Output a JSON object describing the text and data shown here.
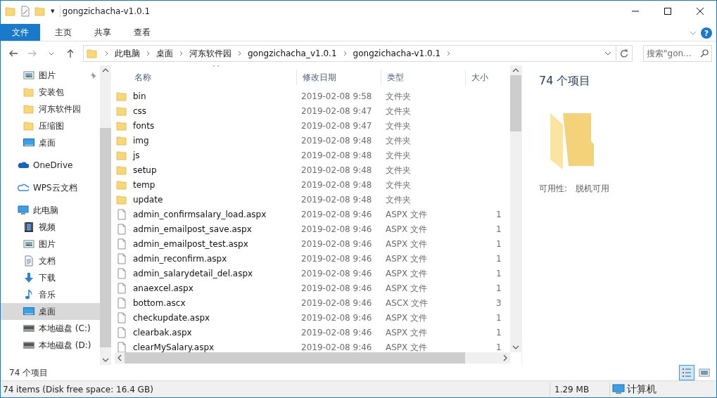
{
  "window": {
    "title": "gongzichacha-v1.0.1",
    "qat_dropdown": "▾"
  },
  "ribbon": {
    "tabs": [
      {
        "label": "文件",
        "selected": false,
        "kind": "file"
      },
      {
        "label": "主页",
        "selected": false,
        "kind": "tab"
      },
      {
        "label": "共享",
        "selected": false,
        "kind": "tab"
      },
      {
        "label": "查看",
        "selected": false,
        "kind": "tab"
      }
    ],
    "help_glyph": "?"
  },
  "address_bar": {
    "segments": [
      "此电脑",
      "桌面",
      "河东软件园",
      "gongzichacha_v1.0.1",
      "gongzichacha-v1.0.1"
    ],
    "search_placeholder": "搜索\"gon..."
  },
  "sidebar": {
    "quick_access": [
      {
        "label": "图片",
        "kind": "pictures",
        "pinned": true,
        "selected": false
      },
      {
        "label": "安装包",
        "kind": "folder",
        "pinned": false,
        "selected": false
      },
      {
        "label": "河东软件园",
        "kind": "folder",
        "pinned": false,
        "selected": false
      },
      {
        "label": "压缩图",
        "kind": "folder",
        "pinned": false,
        "selected": false
      },
      {
        "label": "桌面",
        "kind": "desktop",
        "pinned": false,
        "selected": false
      }
    ],
    "tree": [
      {
        "label": "OneDrive",
        "kind": "onedrive",
        "selected": false
      },
      {
        "label": "WPS云文档",
        "kind": "cloud",
        "selected": false
      },
      {
        "label": "此电脑",
        "kind": "computer",
        "selected": false,
        "children": [
          {
            "label": "视频",
            "kind": "video",
            "selected": false
          },
          {
            "label": "图片",
            "kind": "pictures",
            "selected": false
          },
          {
            "label": "文档",
            "kind": "docs",
            "selected": false
          },
          {
            "label": "下载",
            "kind": "download",
            "selected": false
          },
          {
            "label": "音乐",
            "kind": "music",
            "selected": false
          },
          {
            "label": "桌面",
            "kind": "desktop",
            "selected": true
          },
          {
            "label": "本地磁盘 (C:)",
            "kind": "drive",
            "selected": false
          },
          {
            "label": "本地磁盘 (D:)",
            "kind": "drive",
            "selected": false
          }
        ]
      }
    ]
  },
  "file_list": {
    "columns": [
      "名称",
      "修改日期",
      "类型",
      "大小"
    ],
    "rows": [
      {
        "name": "bin",
        "kind": "folder",
        "modified": "2019-02-08 9:58",
        "type": "文件夹"
      },
      {
        "name": "css",
        "kind": "folder",
        "modified": "2019-02-08 9:47",
        "type": "文件夹"
      },
      {
        "name": "fonts",
        "kind": "folder",
        "modified": "2019-02-08 9:47",
        "type": "文件夹"
      },
      {
        "name": "img",
        "kind": "folder",
        "modified": "2019-02-08 9:48",
        "type": "文件夹"
      },
      {
        "name": "js",
        "kind": "folder",
        "modified": "2019-02-08 9:48",
        "type": "文件夹"
      },
      {
        "name": "setup",
        "kind": "folder",
        "modified": "2019-02-08 9:48",
        "type": "文件夹"
      },
      {
        "name": "temp",
        "kind": "folder",
        "modified": "2019-02-08 9:48",
        "type": "文件夹"
      },
      {
        "name": "update",
        "kind": "folder",
        "modified": "2019-02-08 9:48",
        "type": "文件夹"
      },
      {
        "name": "admin_confirmsalary_load.aspx",
        "kind": "file",
        "modified": "2019-02-08 9:46",
        "type": "ASPX 文件",
        "size": "1"
      },
      {
        "name": "admin_emailpost_save.aspx",
        "kind": "file",
        "modified": "2019-02-08 9:46",
        "type": "ASPX 文件",
        "size": "1"
      },
      {
        "name": "admin_emailpost_test.aspx",
        "kind": "file",
        "modified": "2019-02-08 9:46",
        "type": "ASPX 文件",
        "size": "1"
      },
      {
        "name": "admin_reconfirm.aspx",
        "kind": "file",
        "modified": "2019-02-08 9:46",
        "type": "ASPX 文件",
        "size": "1"
      },
      {
        "name": "admin_salarydetail_del.aspx",
        "kind": "file",
        "modified": "2019-02-08 9:46",
        "type": "ASPX 文件",
        "size": "1"
      },
      {
        "name": "anaexcel.aspx",
        "kind": "file",
        "modified": "2019-02-08 9:46",
        "type": "ASPX 文件",
        "size": "1"
      },
      {
        "name": "bottom.ascx",
        "kind": "file",
        "modified": "2019-02-08 9:46",
        "type": "ASCX 文件",
        "size": "3"
      },
      {
        "name": "checkupdate.aspx",
        "kind": "file",
        "modified": "2019-02-08 9:46",
        "type": "ASPX 文件",
        "size": "1"
      },
      {
        "name": "clearbak.aspx",
        "kind": "file",
        "modified": "2019-02-08 9:46",
        "type": "ASPX 文件",
        "size": "1"
      },
      {
        "name": "clearMySalary.aspx",
        "kind": "file",
        "modified": "2019-02-08 9:46",
        "type": "ASPX 文件",
        "size": "1"
      }
    ]
  },
  "details_pane": {
    "title": "74 个项目",
    "property_label": "可用性:",
    "property_value": "脱机可用"
  },
  "item_count": "74 个项目",
  "view_buttons": [
    {
      "kind": "details",
      "selected": true
    },
    {
      "kind": "thumbnails",
      "selected": false
    }
  ],
  "status_bar": {
    "summary": "74 items (Disk free space: 16.4 GB)",
    "size": "1.29 MB",
    "location": "计算机"
  }
}
